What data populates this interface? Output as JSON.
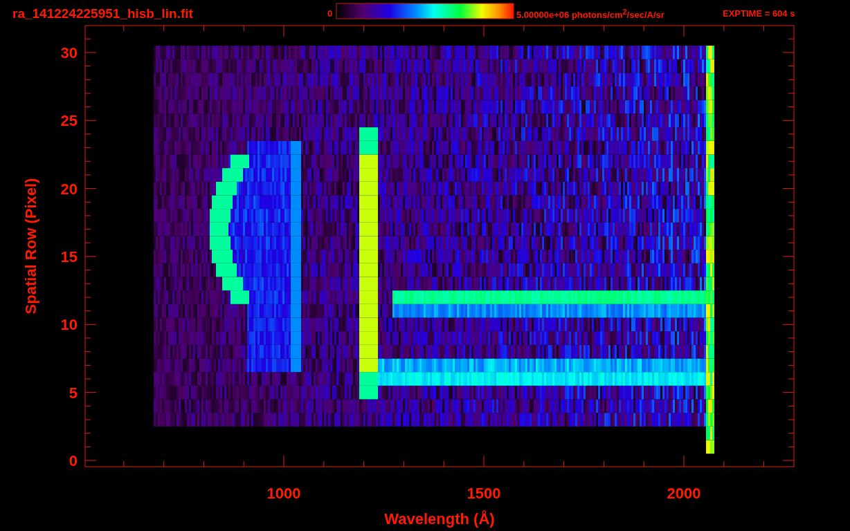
{
  "title": "ra_141224225951_hisb_lin.fit",
  "colorbar": {
    "min_label": "0",
    "max_label": "5.00000e+06 photons/cm$^{2}$/sec/A/sr"
  },
  "exptime": "EXPTIME = 604 s",
  "plot": {
    "xlabel": "Wavelength (Å)",
    "ylabel": "Spatial Row (Pixel)",
    "xticks": [
      "1000",
      "1500",
      "2000"
    ],
    "yticks": [
      "30",
      "25",
      "20",
      "15",
      "10",
      "5",
      "0"
    ]
  }
}
